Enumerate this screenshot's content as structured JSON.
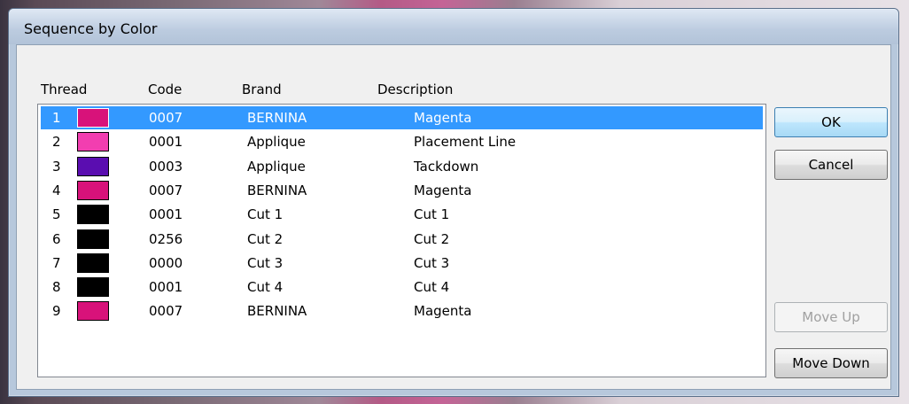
{
  "window": {
    "title": "Sequence by Color"
  },
  "columns": {
    "thread": "Thread",
    "code": "Code",
    "brand": "Brand",
    "description": "Description"
  },
  "rows": [
    {
      "thread": "1",
      "color": "#d8127a",
      "code": "0007",
      "brand": "BERNINA",
      "description": "Magenta",
      "selected": true
    },
    {
      "thread": "2",
      "color": "#f23eb0",
      "code": "0001",
      "brand": "Applique",
      "description": "Placement Line"
    },
    {
      "thread": "3",
      "color": "#5a0db0",
      "code": "0003",
      "brand": "Applique",
      "description": "Tackdown"
    },
    {
      "thread": "4",
      "color": "#d8127a",
      "code": "0007",
      "brand": "BERNINA",
      "description": "Magenta"
    },
    {
      "thread": "5",
      "color": "#000000",
      "code": "0001",
      "brand": "Cut 1",
      "description": "Cut 1"
    },
    {
      "thread": "6",
      "color": "#000000",
      "code": "0256",
      "brand": "Cut 2",
      "description": "Cut 2"
    },
    {
      "thread": "7",
      "color": "#000000",
      "code": "0000",
      "brand": "Cut 3",
      "description": "Cut 3"
    },
    {
      "thread": "8",
      "color": "#000000",
      "code": "0001",
      "brand": "Cut 4",
      "description": "Cut 4"
    },
    {
      "thread": "9",
      "color": "#d8127a",
      "code": "0007",
      "brand": "BERNINA",
      "description": "Magenta"
    }
  ],
  "buttons": {
    "ok": "OK",
    "cancel": "Cancel",
    "move_up": "Move Up",
    "move_down": "Move Down"
  },
  "colors": {
    "selection": "#3399ff"
  }
}
